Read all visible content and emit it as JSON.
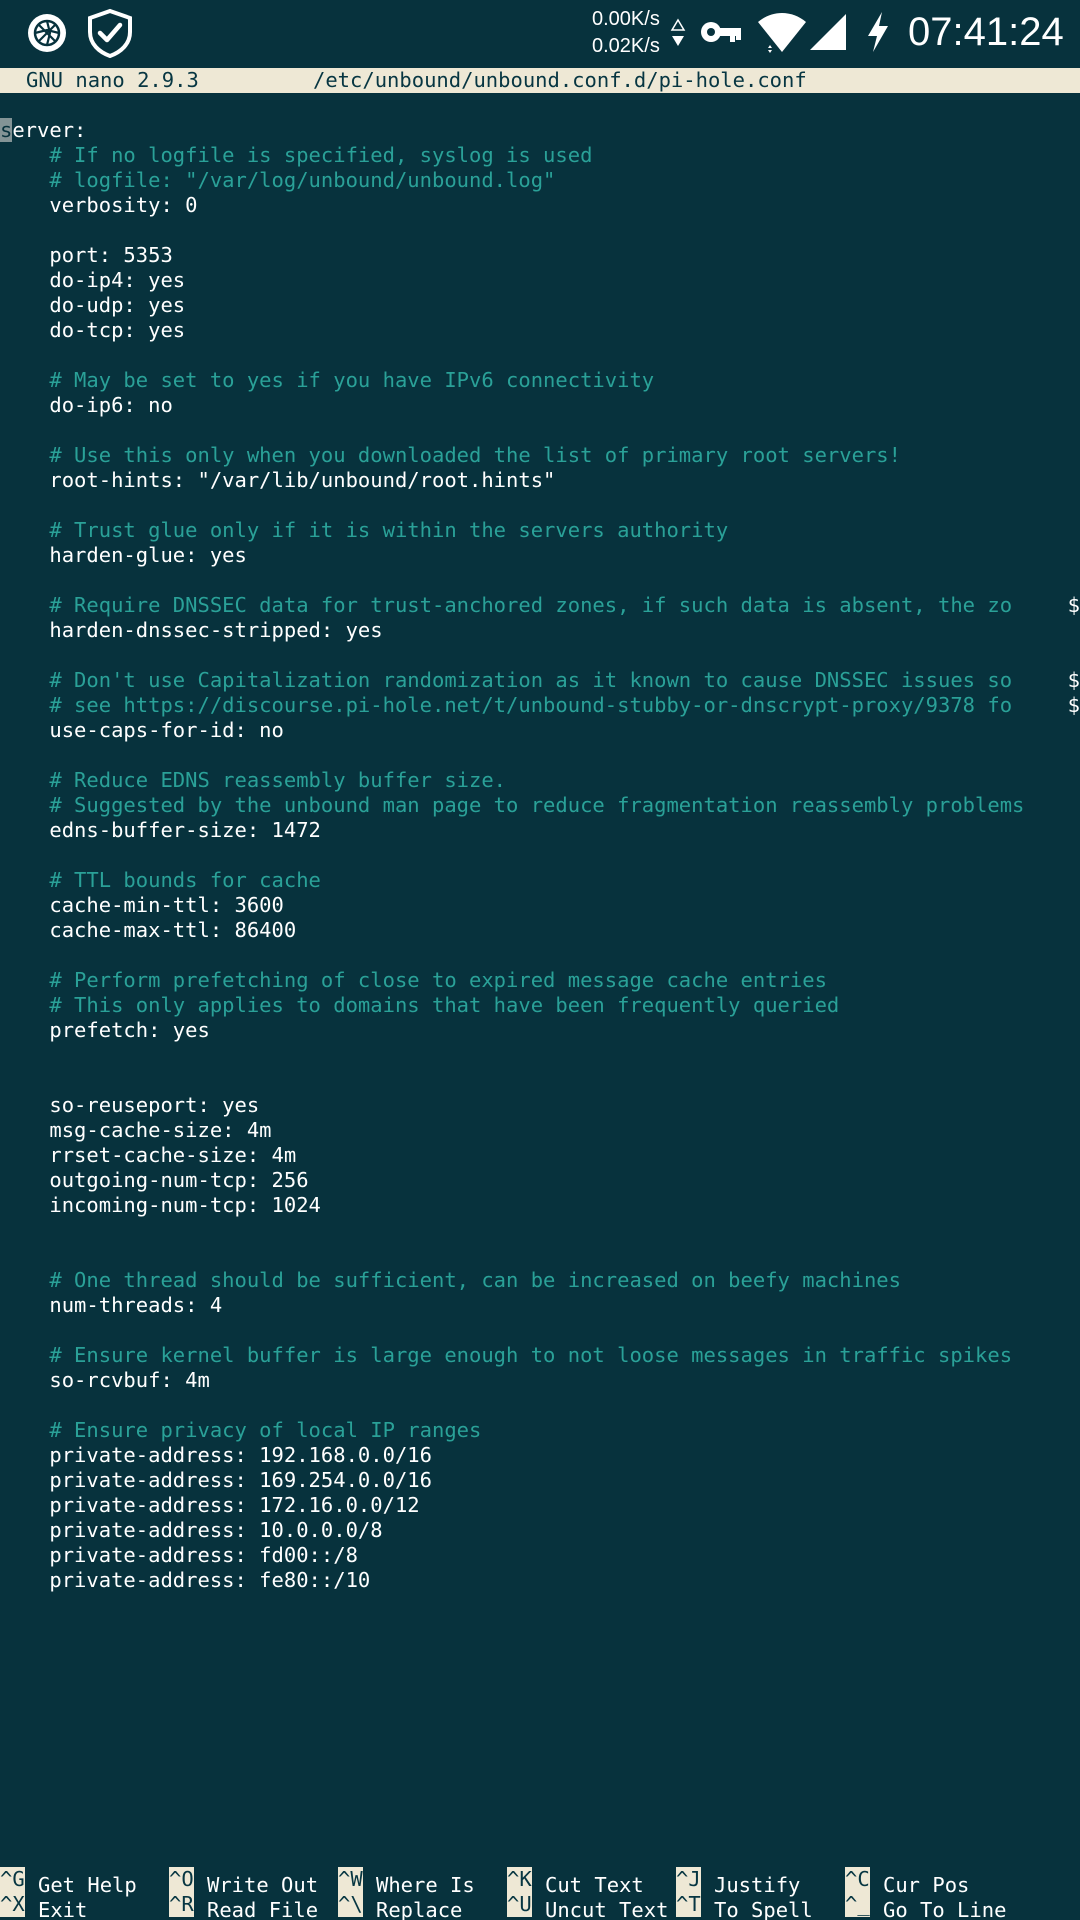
{
  "status_bar": {
    "net_down": "0.00K/s",
    "net_up": "0.02K/s",
    "clock": "07:41:24",
    "icons": [
      "app-icon",
      "vpn-shield-icon",
      "net-arrows-icon",
      "vpn-key-icon",
      "wifi-icon",
      "cell-signal-icon",
      "charging-bolt-icon"
    ]
  },
  "titlebar": {
    "version": "GNU nano 2.9.3",
    "filename": "/etc/unbound/unbound.conf.d/pi-hole.conf"
  },
  "editor": {
    "lines": [
      {
        "text": "server:",
        "kind": "setting"
      },
      {
        "text": "    # If no logfile is specified, syslog is used",
        "kind": "comment"
      },
      {
        "text": "    # logfile: \"/var/log/unbound/unbound.log\"",
        "kind": "comment"
      },
      {
        "text": "    verbosity: 0",
        "kind": "setting"
      },
      {
        "text": "",
        "kind": "blank"
      },
      {
        "text": "    port: 5353",
        "kind": "setting"
      },
      {
        "text": "    do-ip4: yes",
        "kind": "setting"
      },
      {
        "text": "    do-udp: yes",
        "kind": "setting"
      },
      {
        "text": "    do-tcp: yes",
        "kind": "setting"
      },
      {
        "text": "",
        "kind": "blank"
      },
      {
        "text": "    # May be set to yes if you have IPv6 connectivity",
        "kind": "comment"
      },
      {
        "text": "    do-ip6: no",
        "kind": "setting"
      },
      {
        "text": "",
        "kind": "blank"
      },
      {
        "text": "    # Use this only when you downloaded the list of primary root servers!",
        "kind": "comment"
      },
      {
        "text": "    root-hints: \"/var/lib/unbound/root.hints\"",
        "kind": "setting"
      },
      {
        "text": "",
        "kind": "blank"
      },
      {
        "text": "    # Trust glue only if it is within the servers authority",
        "kind": "comment"
      },
      {
        "text": "    harden-glue: yes",
        "kind": "setting"
      },
      {
        "text": "",
        "kind": "blank"
      },
      {
        "text": "    # Require DNSSEC data for trust-anchored zones, if such data is absent, the zo",
        "kind": "comment",
        "overflow": "$"
      },
      {
        "text": "    harden-dnssec-stripped: yes",
        "kind": "setting"
      },
      {
        "text": "",
        "kind": "blank"
      },
      {
        "text": "    # Don't use Capitalization randomization as it known to cause DNSSEC issues so",
        "kind": "comment",
        "overflow": "$"
      },
      {
        "text": "    # see https://discourse.pi-hole.net/t/unbound-stubby-or-dnscrypt-proxy/9378 fo",
        "kind": "comment",
        "overflow": "$"
      },
      {
        "text": "    use-caps-for-id: no",
        "kind": "setting"
      },
      {
        "text": "",
        "kind": "blank"
      },
      {
        "text": "    # Reduce EDNS reassembly buffer size.",
        "kind": "comment"
      },
      {
        "text": "    # Suggested by the unbound man page to reduce fragmentation reassembly problems",
        "kind": "comment"
      },
      {
        "text": "    edns-buffer-size: 1472",
        "kind": "setting"
      },
      {
        "text": "",
        "kind": "blank"
      },
      {
        "text": "    # TTL bounds for cache",
        "kind": "comment"
      },
      {
        "text": "    cache-min-ttl: 3600",
        "kind": "setting"
      },
      {
        "text": "    cache-max-ttl: 86400",
        "kind": "setting"
      },
      {
        "text": "",
        "kind": "blank"
      },
      {
        "text": "    # Perform prefetching of close to expired message cache entries",
        "kind": "comment"
      },
      {
        "text": "    # This only applies to domains that have been frequently queried",
        "kind": "comment"
      },
      {
        "text": "    prefetch: yes",
        "kind": "setting"
      },
      {
        "text": "",
        "kind": "blank"
      },
      {
        "text": "",
        "kind": "blank"
      },
      {
        "text": "    so-reuseport: yes",
        "kind": "setting"
      },
      {
        "text": "    msg-cache-size: 4m",
        "kind": "setting"
      },
      {
        "text": "    rrset-cache-size: 4m",
        "kind": "setting"
      },
      {
        "text": "    outgoing-num-tcp: 256",
        "kind": "setting"
      },
      {
        "text": "    incoming-num-tcp: 1024",
        "kind": "setting"
      },
      {
        "text": "",
        "kind": "blank"
      },
      {
        "text": "",
        "kind": "blank"
      },
      {
        "text": "    # One thread should be sufficient, can be increased on beefy machines",
        "kind": "comment"
      },
      {
        "text": "    num-threads: 4",
        "kind": "setting"
      },
      {
        "text": "",
        "kind": "blank"
      },
      {
        "text": "    # Ensure kernel buffer is large enough to not loose messages in traffic spikes",
        "kind": "comment"
      },
      {
        "text": "    so-rcvbuf: 4m",
        "kind": "setting"
      },
      {
        "text": "",
        "kind": "blank"
      },
      {
        "text": "    # Ensure privacy of local IP ranges",
        "kind": "comment"
      },
      {
        "text": "    private-address: 192.168.0.0/16",
        "kind": "setting"
      },
      {
        "text": "    private-address: 169.254.0.0/16",
        "kind": "setting"
      },
      {
        "text": "    private-address: 172.16.0.0/12",
        "kind": "setting"
      },
      {
        "text": "    private-address: 10.0.0.0/8",
        "kind": "setting"
      },
      {
        "text": "    private-address: fd00::/8",
        "kind": "setting"
      },
      {
        "text": "    private-address: fe80::/10",
        "kind": "setting"
      }
    ]
  },
  "shortcuts": [
    {
      "key": "^G",
      "label": "Get Help"
    },
    {
      "key": "^O",
      "label": "Write Out"
    },
    {
      "key": "^W",
      "label": "Where Is"
    },
    {
      "key": "^K",
      "label": "Cut Text"
    },
    {
      "key": "^J",
      "label": "Justify"
    },
    {
      "key": "^C",
      "label": "Cur Pos"
    },
    {
      "key": "^X",
      "label": "Exit"
    },
    {
      "key": "^R",
      "label": "Read File"
    },
    {
      "key": "^\\",
      "label": "Replace"
    },
    {
      "key": "^U",
      "label": "Uncut Text"
    },
    {
      "key": "^T",
      "label": "To Spell"
    },
    {
      "key": "^_",
      "label": "Go To Line"
    }
  ],
  "colors": {
    "background": "#07323d",
    "comment": "#2aa198",
    "text": "#ffffff",
    "titlebar_bg": "#eee8d5",
    "titlebar_fg": "#073642"
  }
}
